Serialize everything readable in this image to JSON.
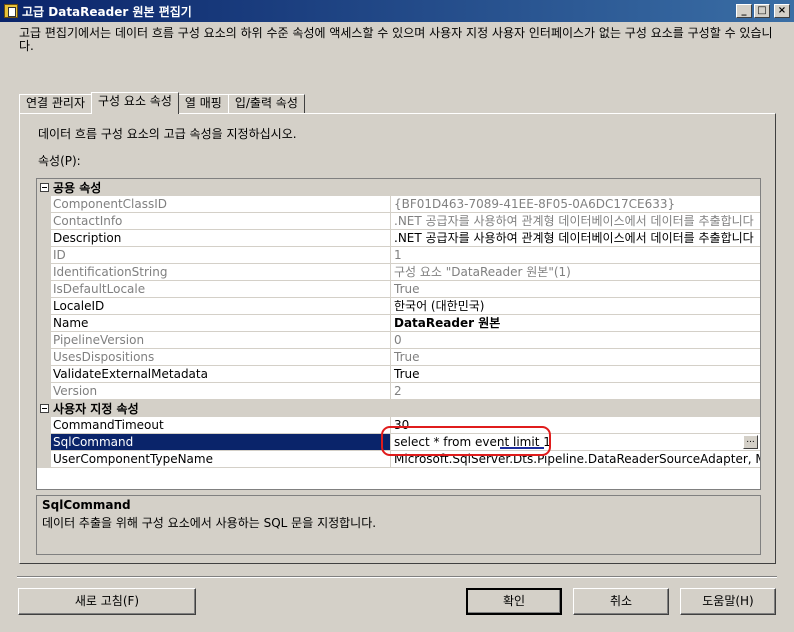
{
  "window": {
    "title": "고급 DataReader 원본 편집기",
    "controls": [
      "_",
      "□",
      "×"
    ]
  },
  "description": "고급 편집기에서는 데이터 흐름 구성 요소의 하위 수준 속성에 액세스할 수 있으며 사용자 지정 사용자 인터페이스가 없는 구성 요소를 구성할 수 있습니다.",
  "tabs": [
    {
      "label": "연결 관리자",
      "active": false
    },
    {
      "label": "구성 요소 속성",
      "active": true
    },
    {
      "label": "열 매핑",
      "active": false
    },
    {
      "label": "입/출력 속성",
      "active": false
    }
  ],
  "panel": {
    "instruction": "데이터 흐름 구성 요소의 고급 속성을 지정하십시오.",
    "properties_label": "속성(P):"
  },
  "grid": {
    "categories": [
      {
        "name": "공용 속성",
        "rows": [
          {
            "name": "ComponentClassID",
            "value": "{BF01D463-7089-41EE-8F05-0A6DC17CE633}",
            "readonly": true
          },
          {
            "name": "ContactInfo",
            "value": ".NET 공급자를 사용하여 관계형 데이터베이스에서 데이터를 추출합니다",
            "readonly": true
          },
          {
            "name": "Description",
            "value": ".NET 공급자를 사용하여 관계형 데이터베이스에서 데이터를 추출합니다",
            "readonly": false
          },
          {
            "name": "ID",
            "value": "1",
            "readonly": true
          },
          {
            "name": "IdentificationString",
            "value": "구성 요소 \"DataReader 원본\"(1)",
            "readonly": true
          },
          {
            "name": "IsDefaultLocale",
            "value": "True",
            "readonly": true
          },
          {
            "name": "LocaleID",
            "value": "한국어 (대한민국)",
            "readonly": false
          },
          {
            "name": "Name",
            "value": "DataReader 원본",
            "readonly": false,
            "bold": true
          },
          {
            "name": "PipelineVersion",
            "value": "0",
            "readonly": true
          },
          {
            "name": "UsesDispositions",
            "value": "True",
            "readonly": true
          },
          {
            "name": "ValidateExternalMetadata",
            "value": "True",
            "readonly": false
          },
          {
            "name": "Version",
            "value": "2",
            "readonly": true
          }
        ]
      },
      {
        "name": "사용자 지정 속성",
        "rows": [
          {
            "name": "CommandTimeout",
            "value": "30",
            "readonly": false
          },
          {
            "name": "SqlCommand",
            "value": "select * from event limit 1",
            "readonly": false,
            "selected": true
          },
          {
            "name": "UserComponentTypeName",
            "value": "Microsoft.SqlServer.Dts.Pipeline.DataReaderSourceAdapter, Microsoft",
            "readonly": false
          }
        ]
      }
    ],
    "ellipsis_label": "..."
  },
  "help": {
    "title": "SqlCommand",
    "text": "데이터 추출을 위해 구성 요소에서 사용하는 SQL 문을 지정합니다."
  },
  "buttons": {
    "refresh": "새로 고침(F)",
    "ok": "확인",
    "cancel": "취소",
    "help": "도움말(H)"
  }
}
